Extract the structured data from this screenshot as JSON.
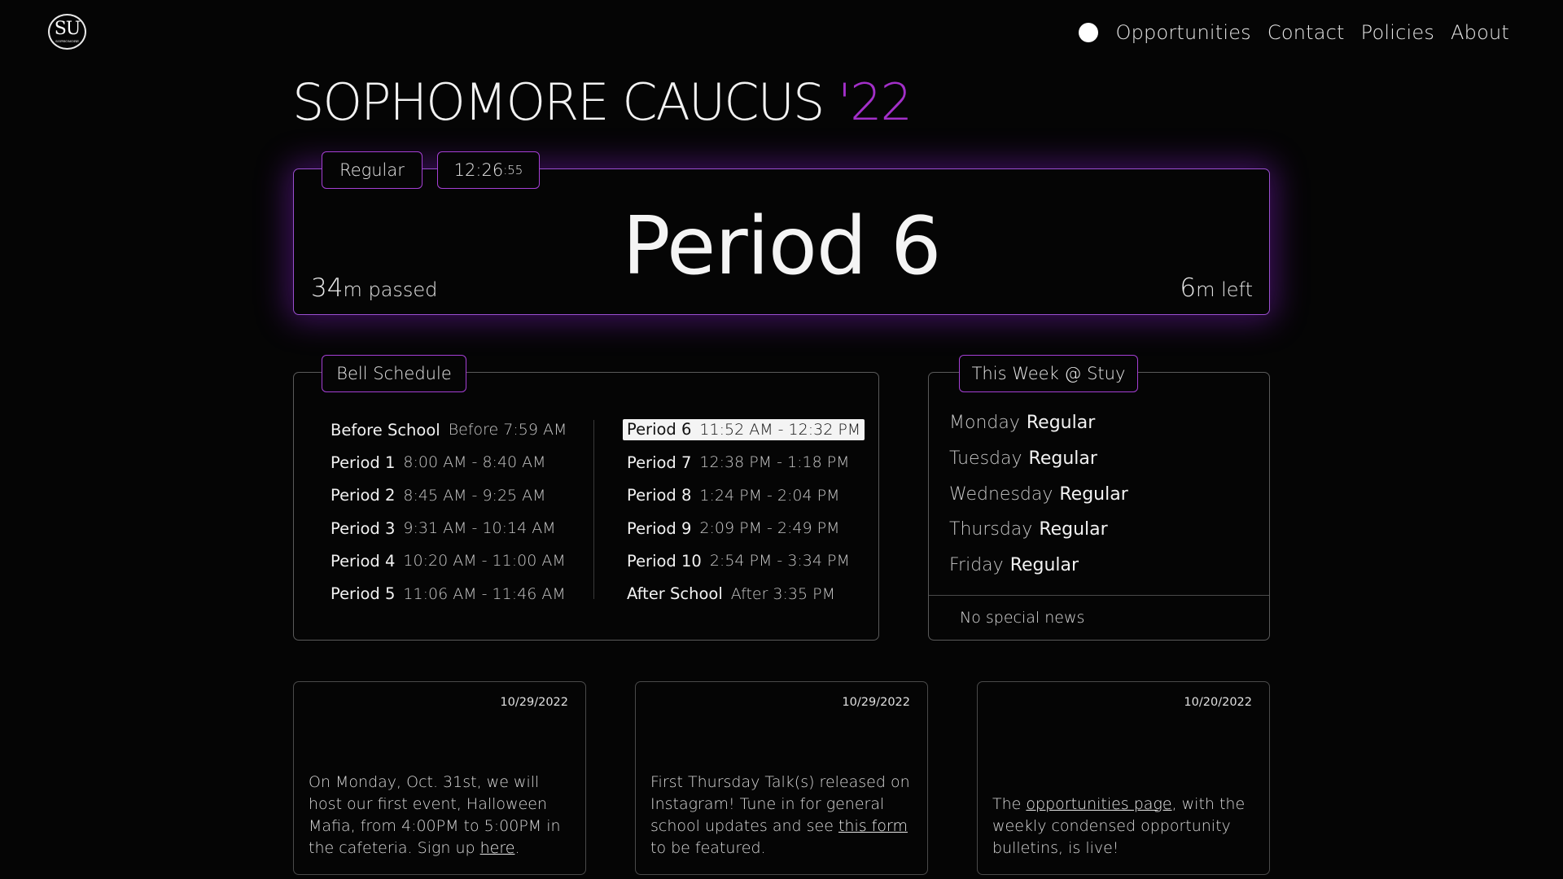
{
  "logo": {
    "monogram": "SU",
    "subtext": "SOPHOMORE"
  },
  "nav": {
    "items": [
      "Opportunities",
      "Contact",
      "Policies",
      "About"
    ]
  },
  "site_title": {
    "main": "SOPHOMORE CAUCUS ",
    "year": "'22"
  },
  "current": {
    "schedule_type": "Regular",
    "clock": {
      "hm": "12:26",
      "sec": ":55"
    },
    "period": "Period 6",
    "passed": {
      "value": "34",
      "unit": "m passed"
    },
    "left": {
      "value": "6",
      "unit": "m left"
    }
  },
  "bell_schedule": {
    "label": "Bell Schedule",
    "left_column": [
      {
        "name": "Before School",
        "time": "Before 7:59 AM"
      },
      {
        "name": "Period 1",
        "time": "8:00 AM - 8:40 AM"
      },
      {
        "name": "Period 2",
        "time": "8:45 AM - 9:25 AM"
      },
      {
        "name": "Period 3",
        "time": "9:31 AM - 10:14 AM"
      },
      {
        "name": "Period 4",
        "time": "10:20 AM - 11:00 AM"
      },
      {
        "name": "Period 5",
        "time": "11:06 AM - 11:46 AM"
      }
    ],
    "right_column": [
      {
        "name": "Period 6",
        "time": "11:52 AM - 12:32 PM"
      },
      {
        "name": "Period 7",
        "time": "12:38 PM - 1:18 PM"
      },
      {
        "name": "Period 8",
        "time": "1:24 PM - 2:04 PM"
      },
      {
        "name": "Period 9",
        "time": "2:09 PM - 2:49 PM"
      },
      {
        "name": "Period 10",
        "time": "2:54 PM - 3:34 PM"
      },
      {
        "name": "After School",
        "time": "After 3:35 PM"
      }
    ]
  },
  "week": {
    "label": "This Week @ Stuy",
    "days": [
      {
        "day": "Monday",
        "type": "Regular"
      },
      {
        "day": "Tuesday",
        "type": "Regular"
      },
      {
        "day": "Wednesday",
        "type": "Regular"
      },
      {
        "day": "Thursday",
        "type": "Regular"
      },
      {
        "day": "Friday",
        "type": "Regular"
      }
    ],
    "news": "No special news"
  },
  "cards": [
    {
      "date": "10/29/2022",
      "text_before": "On Monday, Oct. 31st, we will host our first event, Halloween Mafia, from 4:00PM to 5:00PM in the cafeteria. Sign up ",
      "link": "here",
      "text_after": "."
    },
    {
      "date": "10/29/2022",
      "text_before": "First Thursday Talk(s) released on Instagram! Tune in for general school updates and see ",
      "link": "this form",
      "text_after": " to be featured."
    },
    {
      "date": "10/20/2022",
      "text_before": "The ",
      "link": "opportunities page",
      "text_after": ", with the weekly condensed opportunity bulletins, is live!"
    }
  ],
  "colors": {
    "accent": "#a32fc9",
    "glow": "#8a1ed2",
    "background": "#050505"
  }
}
